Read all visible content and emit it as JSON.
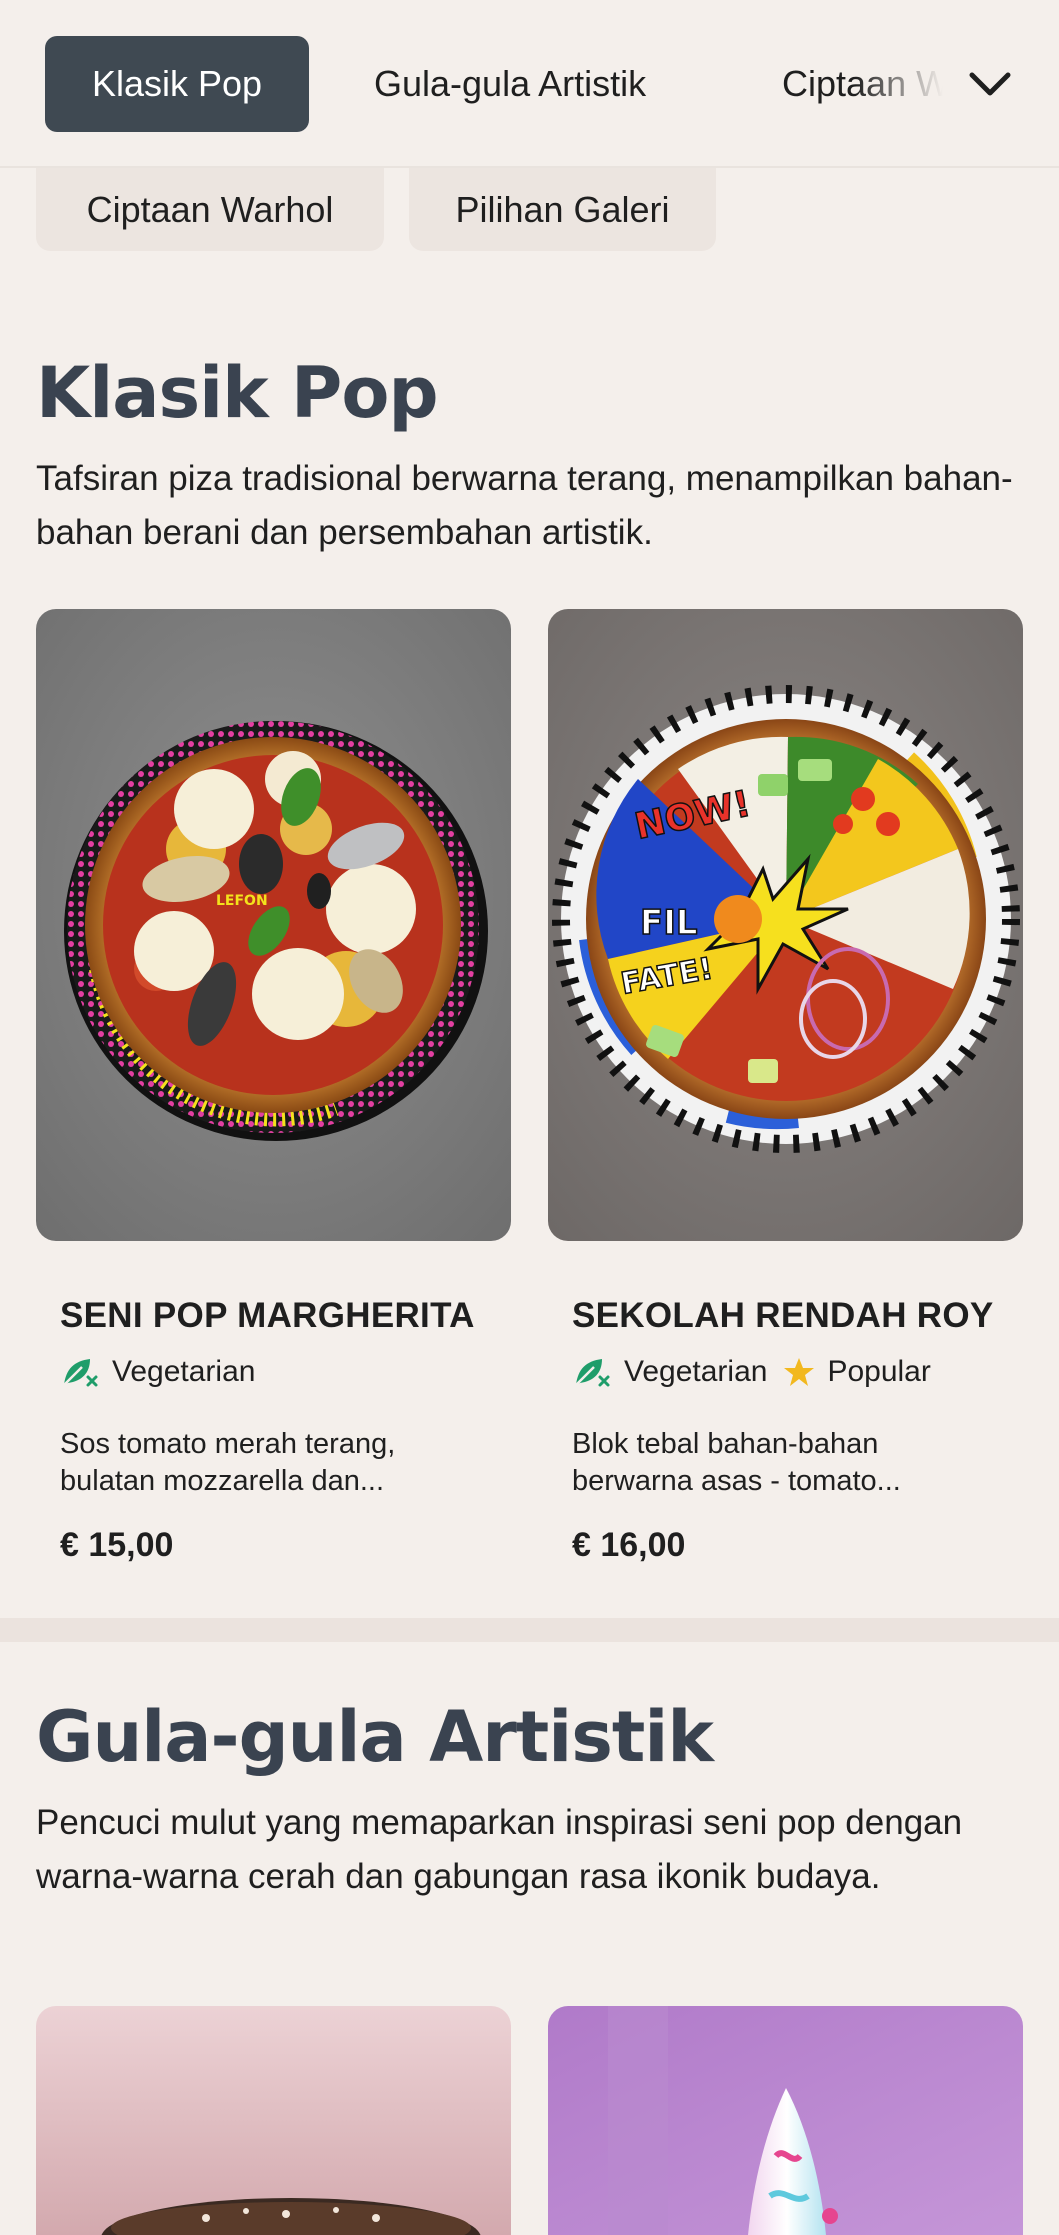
{
  "categories": {
    "active": "Klasik Pop",
    "second": "Gula-gula Artistik",
    "third": "Ciptaan Warhol",
    "chips": [
      "Ciptaan Warhol",
      "Pilihan Galeri"
    ]
  },
  "sections": [
    {
      "title": "Klasik Pop",
      "description": "Tafsiran piza tradisional berwarna terang, menampilkan bahan-bahan berani dan persembahan artistik.",
      "items": [
        {
          "name": "SENI POP MARGHERITA",
          "badges": [
            "Vegetarian"
          ],
          "description": "Sos tomato merah terang, bulatan mozzarella dan...",
          "price": "€ 15,00"
        },
        {
          "name": "SEKOLAH RENDAH ROY",
          "badges": [
            "Vegetarian",
            "Popular"
          ],
          "description": "Blok tebal bahan-bahan berwarna asas - tomato...",
          "price": "€ 16,00"
        }
      ]
    },
    {
      "title": "Gula-gula Artistik",
      "description": "Pencuci mulut yang memaparkan inspirasi seni pop dengan warna-warna cerah dan gabungan rasa ikonik budaya."
    }
  ],
  "plate1_text": "LEFON",
  "plate2_text": [
    "NOW!",
    "FIL",
    "FATE!"
  ],
  "icons": {
    "dropdown": "chevron-down-icon",
    "vegetarian": "vegetarian-leaf-icon",
    "popular": "star-icon"
  },
  "colors": {
    "accent": "#3f4952",
    "background": "#f4efeb",
    "vegetarian": "#1f9d6a",
    "popular": "#f2b81e"
  }
}
